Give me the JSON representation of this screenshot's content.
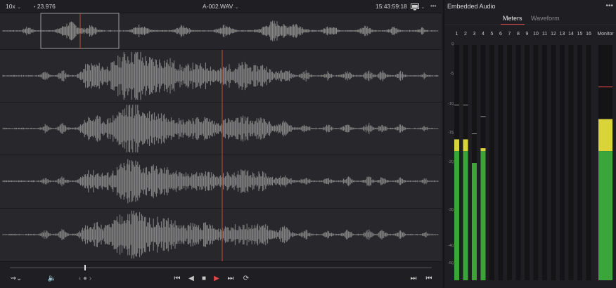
{
  "topbar": {
    "zoom": "10x",
    "framerate": "23.976",
    "filename": "A-002.WAV",
    "timecode": "15:43:59:18",
    "menu": "•••"
  },
  "panel": {
    "title": "Embedded Audio",
    "menu": "•••",
    "tabs": [
      "Meters",
      "Waveform"
    ],
    "active_tab": "Meters",
    "channels": [
      "1",
      "2",
      "3",
      "4",
      "5",
      "6",
      "7",
      "8",
      "9",
      "10",
      "11",
      "12",
      "13",
      "14",
      "15",
      "16"
    ],
    "monitor_label": "Monitor",
    "scale": [
      "0",
      "-5",
      "-10",
      "-15",
      "-20",
      "-30",
      "-40",
      "-50"
    ]
  },
  "meters": {
    "levels_db": {
      "1": -16,
      "2": -16,
      "3": -20,
      "4": -17.5
    },
    "peaks_db": {
      "1": -10,
      "2": -10,
      "3": -15,
      "4": -12
    },
    "monitor_level_db": -12.5,
    "monitor_peak_db": -7,
    "colors": {
      "green": "#3aa63a",
      "yellow": "#d9d43a",
      "peak": "#d04a4a",
      "bg": "#141416"
    }
  },
  "tracks": [
    "overview",
    "track-1",
    "track-2",
    "track-3",
    "track-4"
  ],
  "playhead_color": "#c84a3a",
  "transport": {
    "icons": [
      "waveform-mode-icon",
      "volume-icon",
      "jog-icon",
      "jump-start-icon",
      "step-back-icon",
      "stop-icon",
      "play-icon",
      "step-forward-icon",
      "loop-icon",
      "jump-end-icon",
      "skip-end-icon"
    ]
  }
}
